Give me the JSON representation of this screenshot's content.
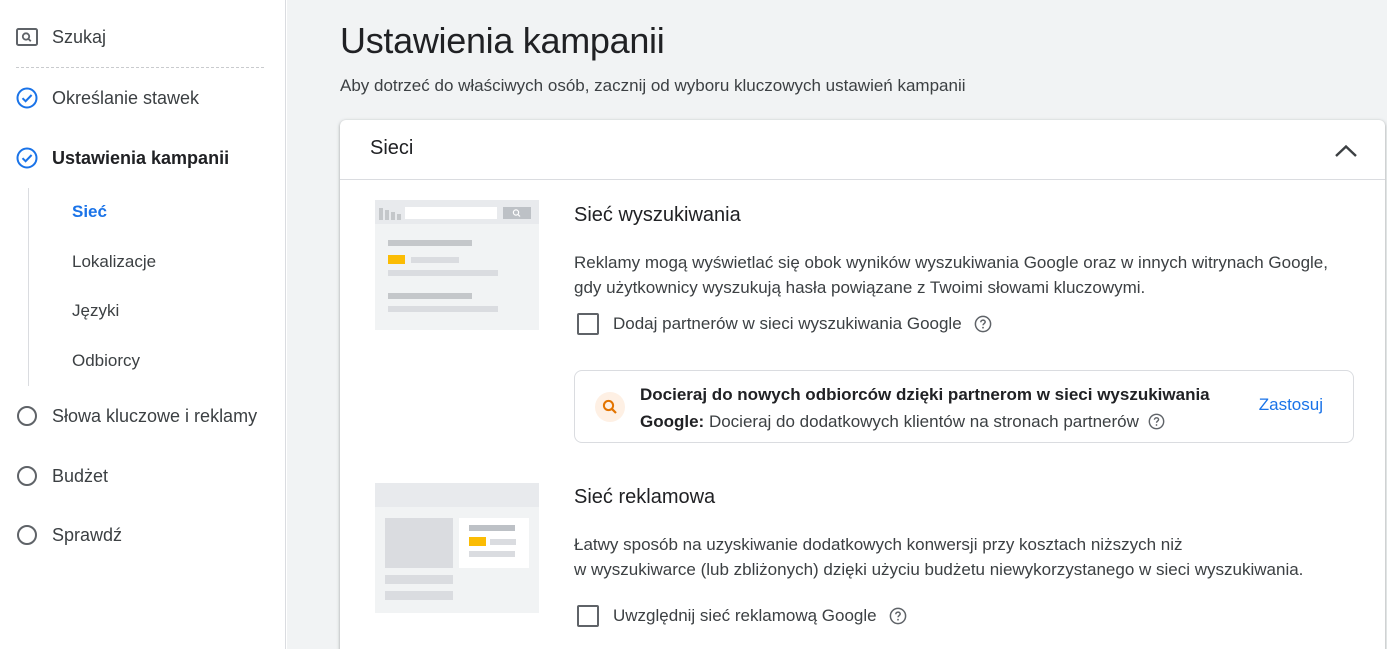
{
  "sidebar": {
    "search_label": "Szukaj",
    "steps": [
      {
        "label": "Określanie stawek",
        "status": "done"
      },
      {
        "label": "Ustawienia kampanii",
        "status": "current"
      }
    ],
    "substeps": [
      "Sieć",
      "Lokalizacje",
      "Języki",
      "Odbiorcy"
    ],
    "active_substep": "Sieć",
    "pending_steps": [
      "Słowa kluczowe i reklamy",
      "Budżet",
      "Sprawdź"
    ]
  },
  "main": {
    "title": "Ustawienia kampanii",
    "subtitle": "Aby dotrzeć do właściwych osób, zacznij od wyboru kluczowych ustawień kampanii",
    "card": {
      "title": "Sieci",
      "search_network": {
        "title": "Sieć wyszukiwania",
        "description": "Reklamy mogą wyświetlać się obok wyników wyszukiwania Google oraz w innych witrynach Google, gdy użytkownicy wyszukują hasła powiązane z Twoimi słowami kluczowymi.",
        "checkbox_label": "Dodaj partnerów w sieci wyszukiwania Google",
        "checked": false
      },
      "promo": {
        "headline_bold": "Docieraj do nowych odbiorców dzięki partnerom w sieci wyszukiwania Google:",
        "body": "Docieraj do dodatkowych klientów na stronach partnerów",
        "apply_label": "Zastosuj"
      },
      "display_network": {
        "title": "Sieć reklamowa",
        "description_line1": "Łatwy sposób na uzyskiwanie dodatkowych konwersji przy kosztach niższych niż",
        "description_line2": "w wyszukiwarce (lub zbliżonych) dzięki użyciu budżetu niewykorzystanego w sieci wyszukiwania.",
        "checkbox_label": "Uwzględnij sieć reklamową Google",
        "checked": false
      }
    }
  },
  "colors": {
    "accent": "#1a73e8",
    "highlight_yellow": "#fbbc04",
    "search_icon_bg": "#fef0e4",
    "search_icon": "#e37400"
  }
}
